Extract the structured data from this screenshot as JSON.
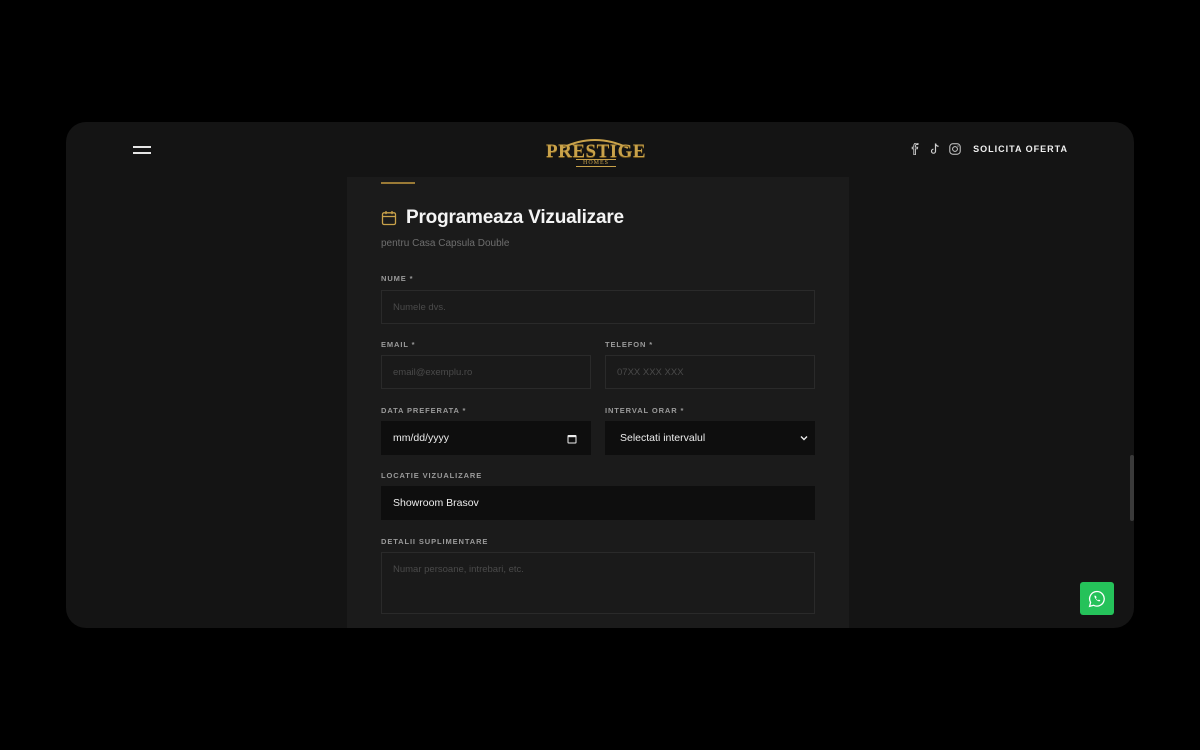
{
  "header": {
    "logo_main": "PRESTIGE",
    "logo_sub": "HOMES",
    "cta_label": "SOLICITA OFERTA",
    "social": [
      "facebook-icon",
      "tiktok-icon",
      "instagram-icon"
    ]
  },
  "form": {
    "title": "Programeaza Vizualizare",
    "subtitle": "pentru Casa Capsula Double",
    "fields": {
      "nume": {
        "label": "NUME *",
        "placeholder": "Numele dvs."
      },
      "email": {
        "label": "EMAIL *",
        "placeholder": "email@exemplu.ro"
      },
      "telefon": {
        "label": "TELEFON *",
        "placeholder": "07XX XXX XXX"
      },
      "data": {
        "label": "DATA PREFERATA *",
        "value": "mm/dd/yyyy"
      },
      "interval": {
        "label": "INTERVAL ORAR *",
        "value": "Selectati intervalul"
      },
      "locatie": {
        "label": "LOCATIE VIZUALIZARE",
        "value": "Showroom Brasov"
      },
      "detalii": {
        "label": "DETALII SUPLIMENTARE",
        "placeholder": "Numar persoane, intrebari, etc."
      }
    }
  },
  "colors": {
    "accent_gold": "#c9a24a",
    "whatsapp_green": "#25c25a",
    "background": "#000000",
    "panel": "#141414"
  }
}
